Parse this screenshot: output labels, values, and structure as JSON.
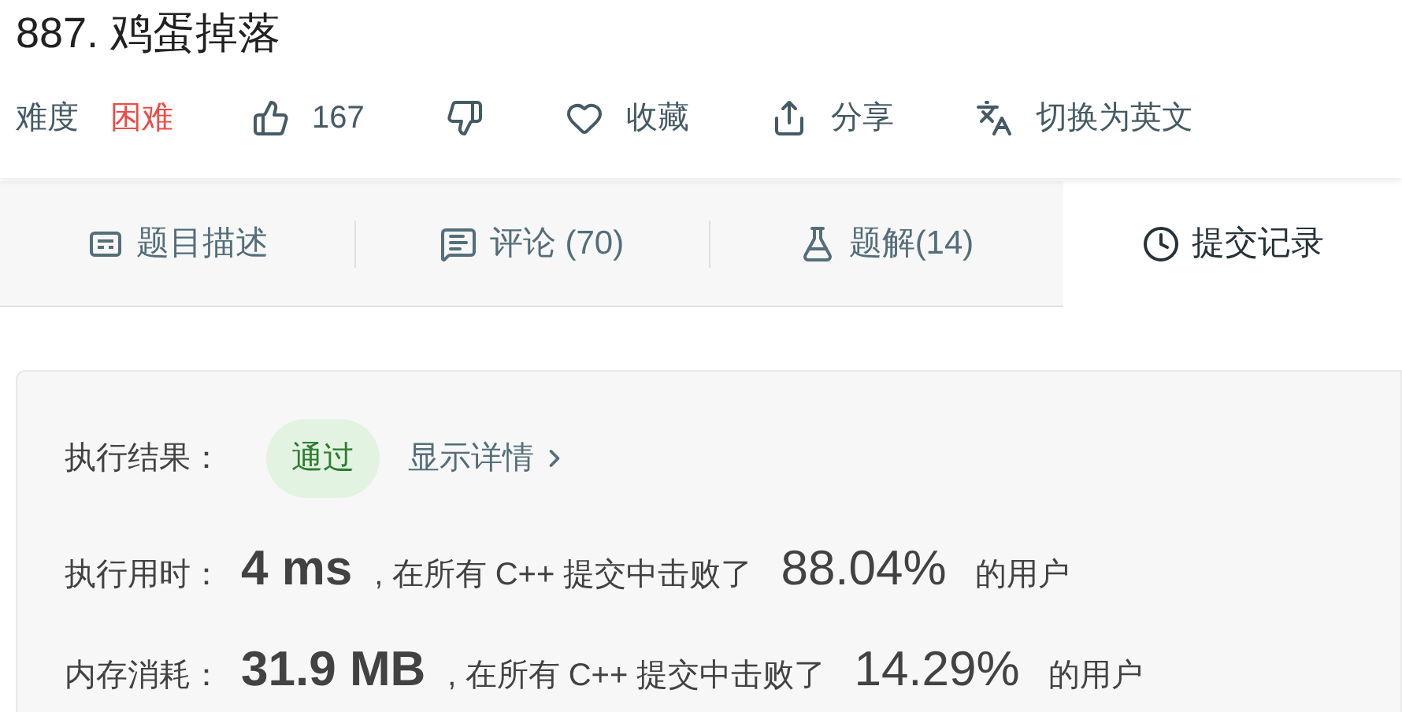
{
  "problem": {
    "title": "887. 鸡蛋掉落",
    "difficulty_label": "难度",
    "difficulty": "困难",
    "actions": [
      {
        "kind": "like",
        "label": "167"
      },
      {
        "kind": "dislike"
      },
      {
        "kind": "favorite",
        "label": "收藏"
      },
      {
        "kind": "share",
        "label": "分享"
      },
      {
        "kind": "translate",
        "label": "切换为英文"
      }
    ]
  },
  "tabs": [
    {
      "kind": "description",
      "label": "题目描述",
      "selected": false
    },
    {
      "kind": "comments",
      "label": "评论 (70)",
      "selected": false
    },
    {
      "kind": "solutions",
      "label": "题解(14)",
      "selected": false
    },
    {
      "kind": "submissions",
      "label": "提交记录",
      "selected": true
    }
  ],
  "result": {
    "label": "执行结果：",
    "status": "通过",
    "details_link": "显示详情",
    "rows": [
      {
        "label": "执行用时：",
        "value": "4 ms",
        "middle": ", 在所有 C++ 提交中击败了",
        "percent": "88.04%",
        "suffix": "的用户"
      },
      {
        "label": "内存消耗：",
        "value": "31.9 MB",
        "middle": ", 在所有 C++ 提交中击败了",
        "percent": "14.29%",
        "suffix": "的用户"
      }
    ]
  }
}
